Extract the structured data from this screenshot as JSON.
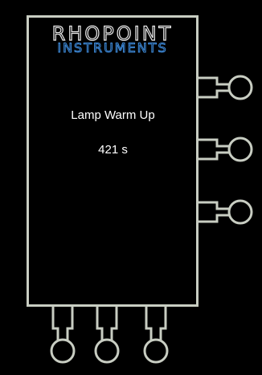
{
  "logo": {
    "line1": "RHOPOINT",
    "line2": "INSTRUMENTS",
    "line1_color": "#e8e8e8",
    "line2_color": "#3f8ee0"
  },
  "screen": {
    "title": "Lamp Warm Up",
    "value": "421 s"
  },
  "colors": {
    "background": "#000000",
    "frame": "#c8cdc2",
    "text": "#ffffff"
  },
  "buttons": {
    "right": [
      "right-button-top",
      "right-button-middle",
      "right-button-bottom"
    ],
    "bottom": [
      "bottom-button-left",
      "bottom-button-center",
      "bottom-button-right"
    ]
  }
}
